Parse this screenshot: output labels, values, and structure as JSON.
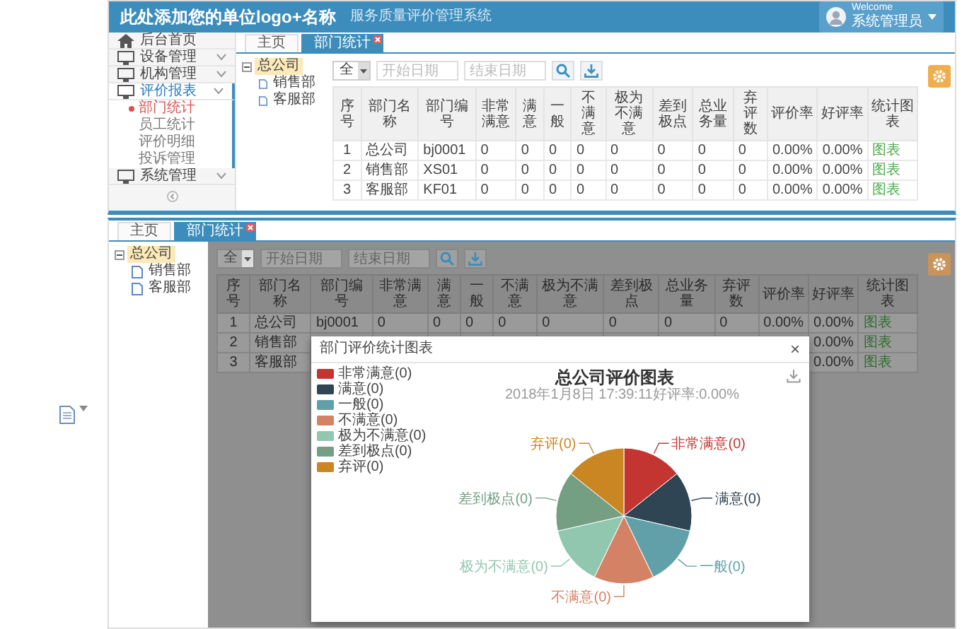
{
  "screen_1": {
    "header": {
      "logo": "此处添加您的单位logo+名称",
      "subtitle": "服务质量评价管理系统",
      "user_greeting": "Welcome",
      "user_name": "系统管理员"
    },
    "sidebar": {
      "items": [
        {
          "label": "后台首页",
          "kind": "home",
          "selected": false
        },
        {
          "label": "设备管理",
          "kind": "menu",
          "selected": false
        },
        {
          "label": "机构管理",
          "kind": "menu",
          "selected": false
        },
        {
          "label": "评价报表",
          "kind": "menu",
          "selected": true,
          "children": [
            {
              "label": "部门统计",
              "selected": true
            },
            {
              "label": "员工统计",
              "selected": false
            },
            {
              "label": "评价明细",
              "selected": false
            },
            {
              "label": "投诉管理",
              "selected": false
            }
          ]
        },
        {
          "label": "系统管理",
          "kind": "menu",
          "selected": false
        }
      ]
    },
    "tabs": [
      {
        "label": "主页",
        "selected": false,
        "closable": false
      },
      {
        "label": "部门统计",
        "selected": true,
        "closable": true
      }
    ],
    "tree": {
      "label": "总公司",
      "selected": true,
      "children": [
        {
          "label": "销售部",
          "selected": false
        },
        {
          "label": "客服部",
          "selected": false
        }
      ]
    },
    "filter": {
      "select_value": "全",
      "start_placeholder": "开始日期",
      "end_placeholder": "结束日期"
    },
    "table": {
      "columns": [
        {
          "label": "序号",
          "kind": "text"
        },
        {
          "label": "部门名称",
          "kind": "text"
        },
        {
          "label": "部门编号",
          "kind": "text"
        },
        {
          "label": "非常满意",
          "kind": "text"
        },
        {
          "label": "满意",
          "kind": "text"
        },
        {
          "label": "一般",
          "kind": "text"
        },
        {
          "label": "不满意",
          "kind": "text"
        },
        {
          "label": "极为不满意",
          "kind": "text"
        },
        {
          "label": "差到极点",
          "kind": "text"
        },
        {
          "label": "总业务量",
          "kind": "text"
        },
        {
          "label": "弃评数",
          "kind": "text"
        },
        {
          "label": "评价率",
          "kind": "text"
        },
        {
          "label": "好评率",
          "kind": "text"
        },
        {
          "label": "统计图表",
          "kind": "link"
        }
      ],
      "rows": [
        [
          "1",
          "总公司",
          "bj0001",
          "0",
          "0",
          "0",
          "0",
          "0",
          "0",
          "0",
          "0",
          "0.00%",
          "0.00%",
          "图表"
        ],
        [
          "2",
          "销售部",
          "XS01",
          "0",
          "0",
          "0",
          "0",
          "0",
          "0",
          "0",
          "0",
          "0.00%",
          "0.00%",
          "图表"
        ],
        [
          "3",
          "客服部",
          "KF01",
          "0",
          "0",
          "0",
          "0",
          "0",
          "0",
          "0",
          "0",
          "0.00%",
          "0.00%",
          "图表"
        ]
      ]
    }
  },
  "screen_2": {
    "tabs": [
      {
        "label": "主页",
        "selected": false,
        "closable": false
      },
      {
        "label": "部门统计",
        "selected": true,
        "closable": true
      }
    ],
    "tree": {
      "label": "总公司",
      "selected": true,
      "children": [
        {
          "label": "销售部",
          "selected": false
        },
        {
          "label": "客服部",
          "selected": false
        }
      ]
    },
    "filter": {
      "select_value": "全",
      "start_placeholder": "开始日期",
      "end_placeholder": "结束日期"
    },
    "table": {
      "columns": [
        {
          "label": "序号",
          "kind": "text"
        },
        {
          "label": "部门名称",
          "kind": "text"
        },
        {
          "label": "部门编号",
          "kind": "text"
        },
        {
          "label": "非常满意",
          "kind": "text"
        },
        {
          "label": "满意",
          "kind": "text"
        },
        {
          "label": "一般",
          "kind": "text"
        },
        {
          "label": "不满意",
          "kind": "text"
        },
        {
          "label": "极为不满意",
          "kind": "text"
        },
        {
          "label": "差到极点",
          "kind": "text"
        },
        {
          "label": "总业务量",
          "kind": "text"
        },
        {
          "label": "弃评数",
          "kind": "text"
        },
        {
          "label": "评价率",
          "kind": "text"
        },
        {
          "label": "好评率",
          "kind": "text"
        },
        {
          "label": "统计图表",
          "kind": "link"
        }
      ],
      "rows": [
        [
          "1",
          "总公司",
          "bj0001",
          "0",
          "0",
          "0",
          "0",
          "0",
          "0",
          "0",
          "0",
          "0.00%",
          "0.00%",
          "图表"
        ],
        [
          "2",
          "销售部",
          null,
          null,
          null,
          null,
          null,
          null,
          null,
          null,
          null,
          null,
          "0.00%",
          "图表"
        ],
        [
          "3",
          "客服部",
          null,
          null,
          null,
          null,
          null,
          null,
          null,
          null,
          null,
          null,
          "0.00%",
          "图表"
        ]
      ]
    },
    "modal": {
      "title": "部门评价统计图表",
      "close_label": "×",
      "chart_title": "总公司评价图表",
      "chart_subtitle": "2018年1月8日 17:39:11好评率:0.00%",
      "legend": [
        {
          "label": "非常满意(0)",
          "color": "#c23531"
        },
        {
          "label": "满意(0)",
          "color": "#2f4554"
        },
        {
          "label": "一般(0)",
          "color": "#61a0a8"
        },
        {
          "label": "不满意(0)",
          "color": "#d48265"
        },
        {
          "label": "极为不满意(0)",
          "color": "#91c7ae"
        },
        {
          "label": "差到极点(0)",
          "color": "#749f83"
        },
        {
          "label": "弃评(0)",
          "color": "#ca8622"
        }
      ],
      "chart_data": {
        "type": "pie",
        "values": [
          14.29,
          14.29,
          14.28,
          14.29,
          14.28,
          14.29,
          14.28
        ],
        "value_labels": [
          "非常满意(0)",
          "满意(0)",
          "一般(0)",
          "不满意(0)",
          "极为不满意(0)",
          "差到极点(0)",
          "弃评(0)"
        ]
      }
    }
  }
}
